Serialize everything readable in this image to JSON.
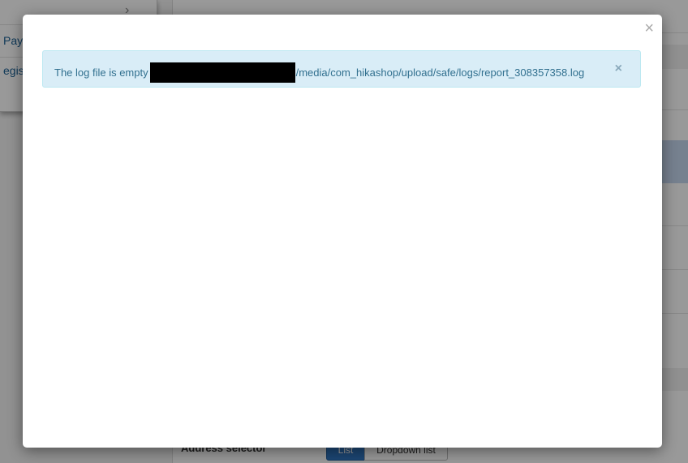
{
  "background": {
    "menu": {
      "item_1": "Pay",
      "item_2": "egistr"
    },
    "address_selector_label": "Address selector",
    "address_selector_options": [
      "List",
      "Dropdown list"
    ]
  },
  "modal": {
    "close_glyph": "×",
    "alert": {
      "prefix": "The log file is empty",
      "path_suffix": "/media/com_hikashop/upload/safe/logs/report_308357358.log",
      "close_glyph": "×",
      "redaction_color": "#000000"
    }
  },
  "colors": {
    "alert_bg": "#d9edf7",
    "alert_text": "#31708f",
    "primary_button": "#2f75c0",
    "overlay": "rgba(0,0,0,0.4)"
  }
}
